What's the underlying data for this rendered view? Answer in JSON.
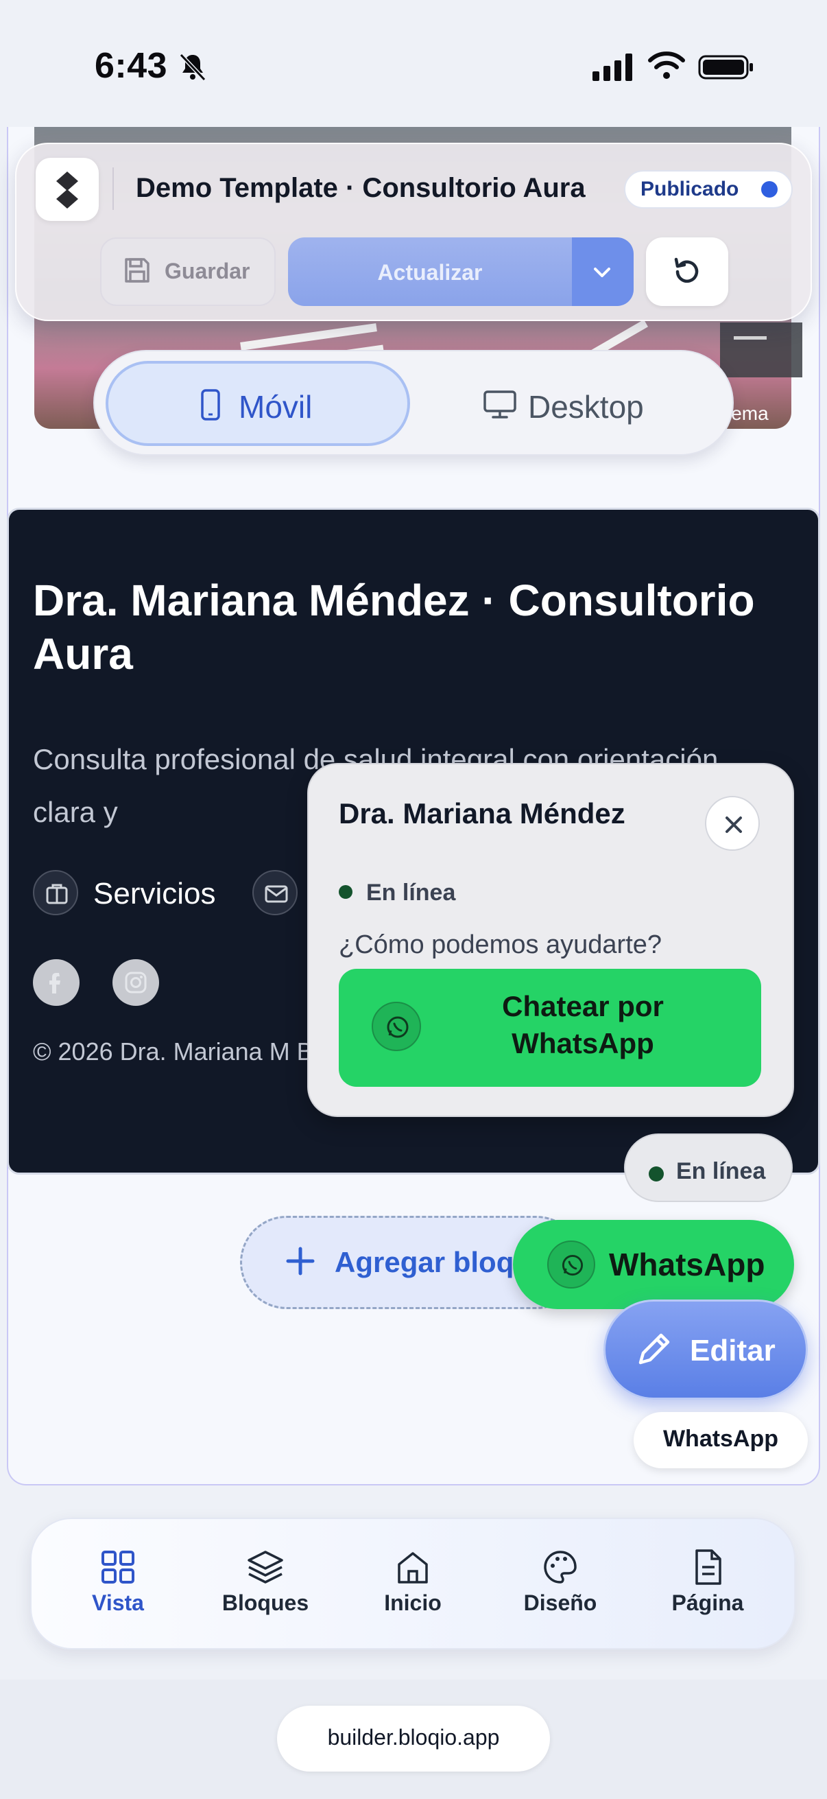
{
  "status_bar": {
    "time": "6:43"
  },
  "hero": {
    "caption": "lema"
  },
  "toolbar": {
    "title": "Demo Template · Consultorio Aura",
    "status_badge": "Publicado",
    "save_label": "Guardar",
    "update_label": "Actualizar"
  },
  "viewport_toggle": {
    "mobile_label": "Móvil",
    "desktop_label": "Desktop",
    "selected": "Móvil"
  },
  "footer_section": {
    "title": "Dra. Mariana Méndez · Consultorio Aura",
    "description": "Consulta profesional de salud integral con orientación clara y",
    "services_label": "Servicios",
    "copyright": "© 2026 Dra. Mariana M Bloqio Builder."
  },
  "chat_popup": {
    "name": "Dra. Mariana Méndez",
    "status": "En línea",
    "question": "¿Cómo podemos ayudarte?",
    "cta_label": "Chatear por WhatsApp"
  },
  "floating": {
    "add_block_label": "Agregar bloque",
    "online_label": "En línea",
    "whatsapp_label": "WhatsApp",
    "edit_label": "Editar",
    "whatsapp_tooltip": "WhatsApp"
  },
  "bottom_nav": {
    "items": [
      {
        "label": "Vista",
        "icon": "grid-icon",
        "active": true
      },
      {
        "label": "Bloques",
        "icon": "layers-icon",
        "active": false
      },
      {
        "label": "Inicio",
        "icon": "home-icon",
        "active": false
      },
      {
        "label": "Diseño",
        "icon": "palette-icon",
        "active": false
      },
      {
        "label": "Página",
        "icon": "page-icon",
        "active": false
      }
    ]
  },
  "browser": {
    "url": "builder.bloqio.app"
  },
  "colors": {
    "accent": "#2f55c9",
    "whatsapp": "#25d366",
    "dark": "#111827"
  }
}
